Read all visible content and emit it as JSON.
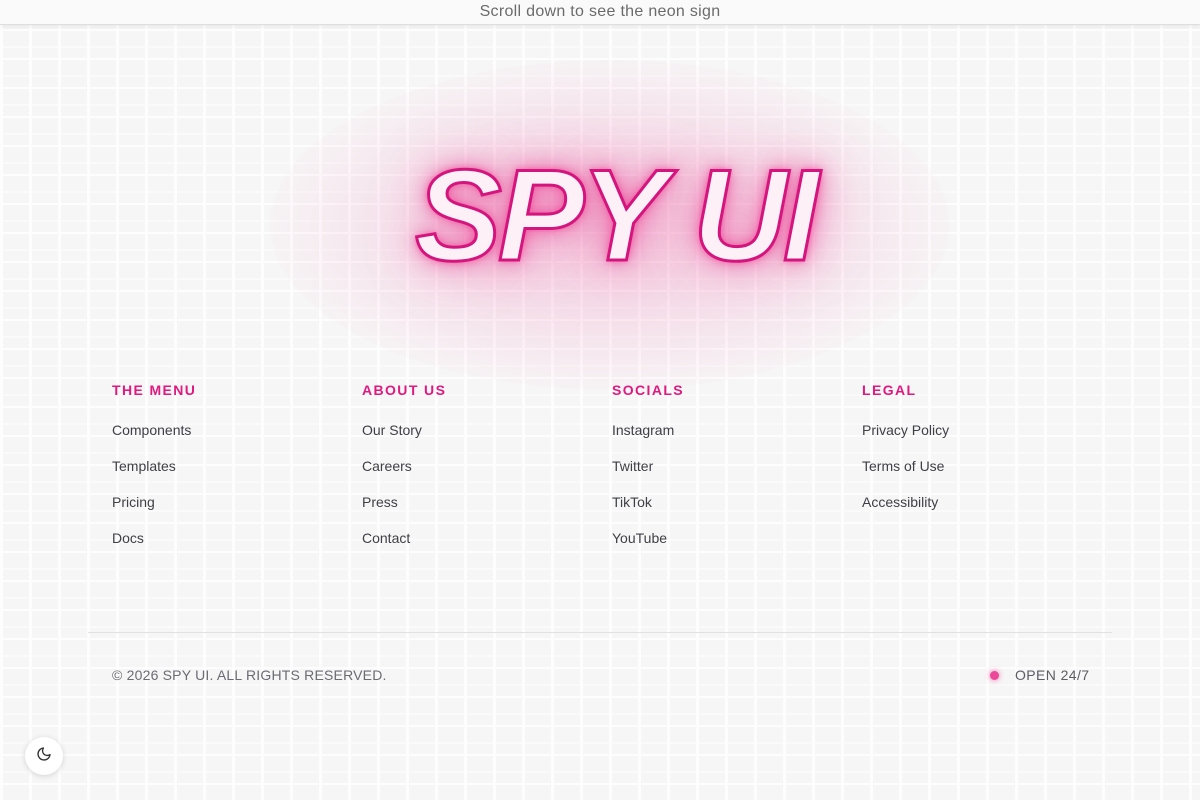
{
  "banner": {
    "text": "Scroll down to see the neon sign"
  },
  "sign": {
    "text": "SPY UI",
    "glow_color": "#ec4899",
    "stroke_color": "#d4157e"
  },
  "footer": {
    "columns": [
      {
        "heading": "THE MENU",
        "links": [
          "Components",
          "Templates",
          "Pricing",
          "Docs"
        ]
      },
      {
        "heading": "ABOUT US",
        "links": [
          "Our Story",
          "Careers",
          "Press",
          "Contact"
        ]
      },
      {
        "heading": "SOCIALS",
        "links": [
          "Instagram",
          "Twitter",
          "TikTok",
          "YouTube"
        ]
      },
      {
        "heading": "LEGAL",
        "links": [
          "Privacy Policy",
          "Terms of Use",
          "Accessibility"
        ]
      }
    ],
    "copyright": "© 2026 SPY UI. ALL RIGHTS RESERVED.",
    "status": "OPEN 24/7"
  },
  "theme_toggle": {
    "icon": "moon-icon"
  },
  "colors": {
    "accent": "#e0197f",
    "background": "#f6f6f6",
    "text": "#3f3f46"
  }
}
